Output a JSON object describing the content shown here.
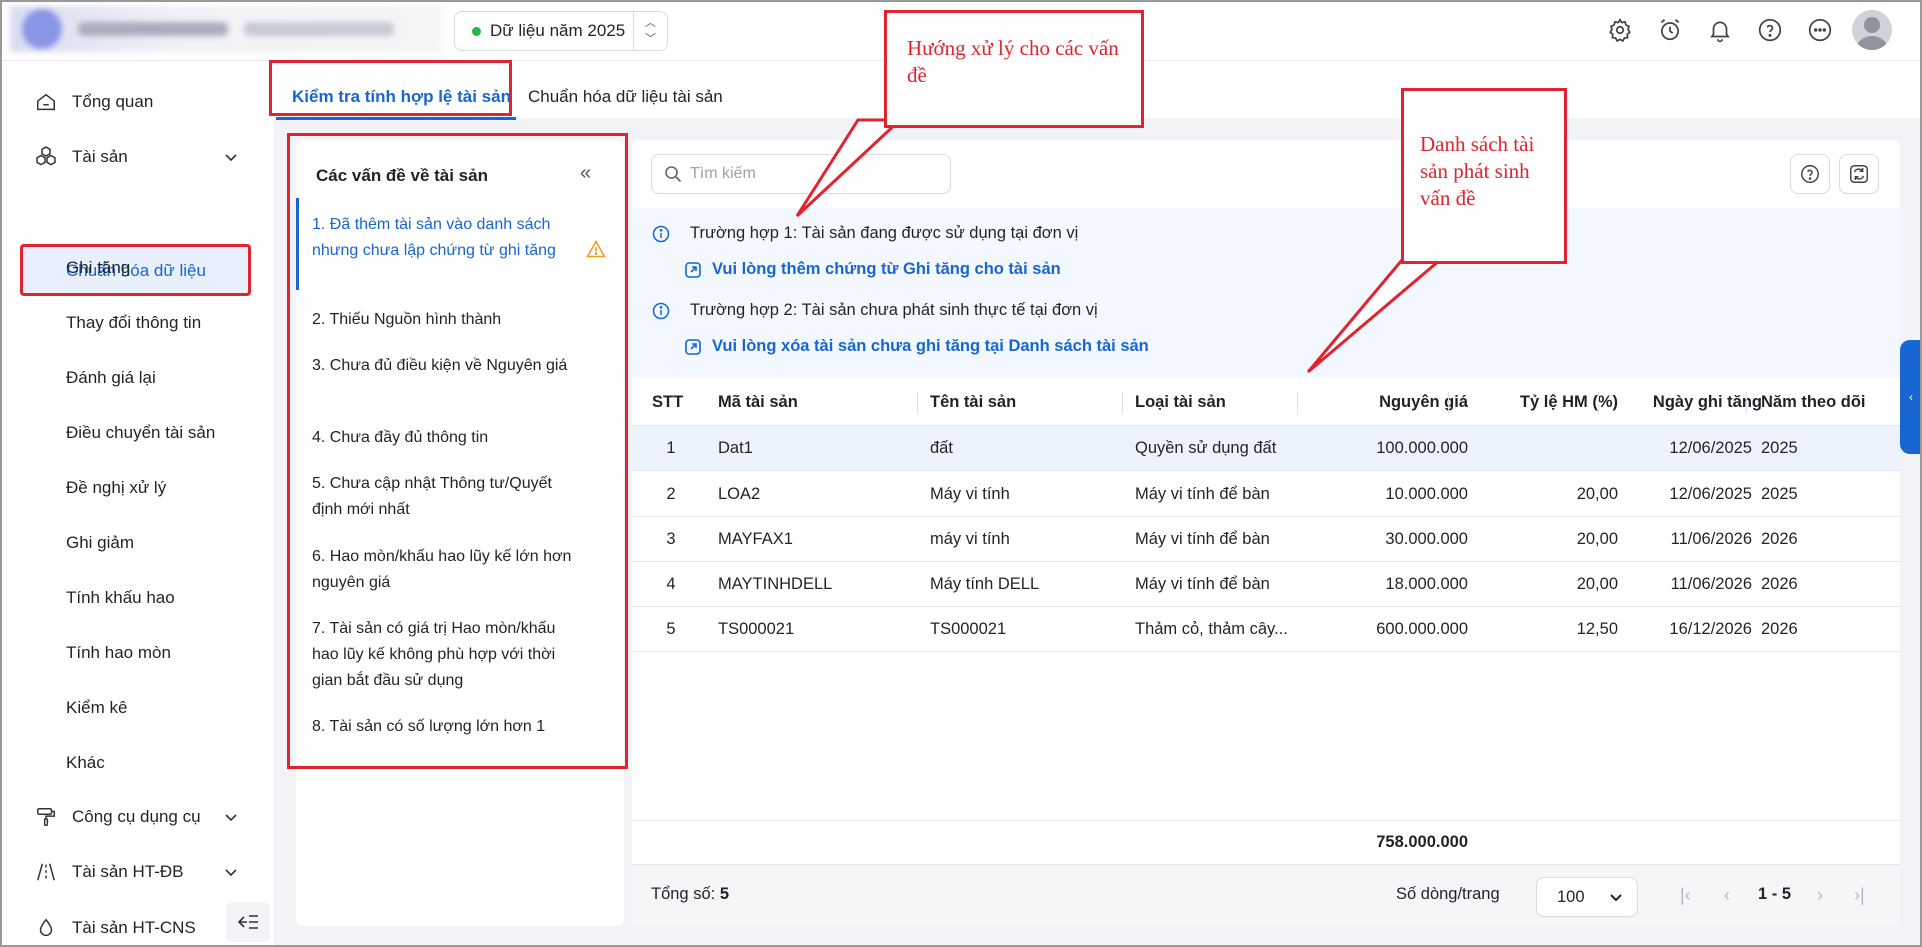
{
  "header": {
    "year_label": "Dữ liệu năm 2025",
    "icons": [
      "gear-icon",
      "alarm-clock-icon",
      "bell-icon",
      "help-icon",
      "more-icon",
      "avatar"
    ]
  },
  "sidebar": {
    "tong_quan": "Tổng quan",
    "tai_san": "Tài sản",
    "sub_items": [
      "Chuẩn hóa dữ liệu",
      "Ghi tăng",
      "Thay đổi thông tin",
      "Đánh giá lại",
      "Điều chuyển tài sản",
      "Đề nghị xử lý",
      "Ghi giảm",
      "Tính khấu hao",
      "Tính hao mòn",
      "Kiểm kê",
      "Khác"
    ],
    "cong_cu": "Công cụ dụng cụ",
    "ht_db": "Tài sản HT-ĐB",
    "ht_cns": "Tài sản HT-CNS"
  },
  "tabs": {
    "active": "Kiểm tra tính hợp lệ tài sản",
    "second": "Chuẩn hóa dữ liệu tài sản"
  },
  "issues": {
    "title": "Các vấn đề về tài sản",
    "items": [
      "1. Đã thêm tài sản vào danh sách nhưng chưa lập chứng từ ghi tăng",
      "2. Thiếu Nguồn hình thành",
      "3. Chưa đủ điều kiện về Nguyên giá",
      "4. Chưa đầy đủ thông tin",
      "5. Chưa cập nhật Thông tư/Quyết định mới nhất",
      "6. Hao mòn/khấu hao lũy kế lớn hơn nguyên giá",
      "7. Tài sản có giá trị Hao mòn/khấu hao lũy kế không phù hợp với thời gian bắt đầu sử dụng",
      "8. Tài sản có số lượng lớn hơn 1"
    ]
  },
  "search": {
    "placeholder": "Tìm kiếm"
  },
  "guide": {
    "case1": "Trường hợp 1: Tài sản đang được sử dụng tại đơn vị",
    "link1": "Vui lòng thêm chứng từ Ghi tăng cho tài sản",
    "case2": "Trường hợp 2: Tài sản chưa phát sinh thực tế tại đơn vị",
    "link2": "Vui lòng xóa tài sản chưa ghi tăng tại Danh sách tài sản"
  },
  "table": {
    "headers": [
      "STT",
      "Mã tài sản",
      "Tên tài sản",
      "Loại tài sản",
      "Nguyên giá",
      "Tỷ lệ HM (%)",
      "Ngày ghi tăng",
      "Năm theo dõi"
    ],
    "rows": [
      [
        "1",
        "Dat1",
        "đất",
        "Quyền sử dụng đất",
        "100.000.000",
        "",
        "12/06/2025",
        "2025"
      ],
      [
        "2",
        "LOA2",
        "Máy vi tính",
        "Máy vi tính để bàn",
        "10.000.000",
        "20,00",
        "12/06/2025",
        "2025"
      ],
      [
        "3",
        "MAYFAX1",
        "máy vi tính",
        "Máy vi tính để bàn",
        "30.000.000",
        "20,00",
        "11/06/2026",
        "2026"
      ],
      [
        "4",
        "MAYTINHDELL",
        "Máy tính DELL",
        "Máy vi tính để bàn",
        "18.000.000",
        "20,00",
        "11/06/2026",
        "2026"
      ],
      [
        "5",
        "TS000021",
        "TS000021",
        "Thảm cỏ, thảm cây...",
        "600.000.000",
        "12,50",
        "16/12/2026",
        "2026"
      ]
    ],
    "total": "758.000.000"
  },
  "footer": {
    "total_label": "Tổng số:",
    "total_value": "5",
    "rows_label": "Số dòng/trang",
    "rows_value": "100",
    "range": "1 - 5"
  },
  "callouts": {
    "handling": "Hướng xử lý cho các vấn đề",
    "list": "Danh sách tài sản phát sinh vấn đề"
  },
  "colors": {
    "accent": "#1766d1",
    "annotation_red": "#e0242f",
    "status_green": "#1fb84a",
    "warning": "#f0a020"
  }
}
